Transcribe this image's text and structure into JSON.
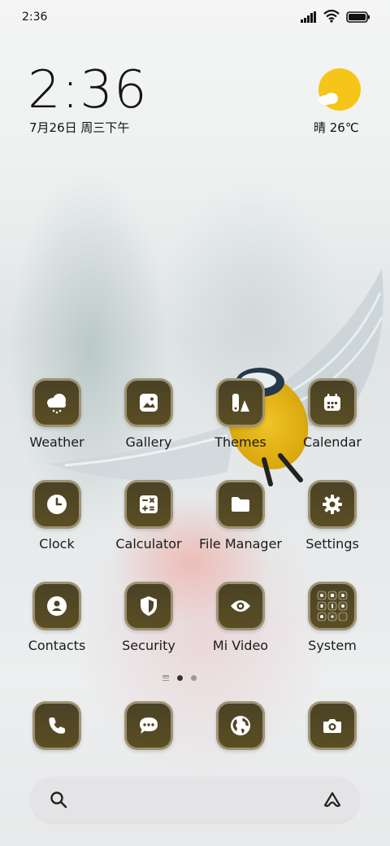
{
  "status_bar": {
    "time": "2:36"
  },
  "widget": {
    "time": "2:36",
    "date": "7月26日 周三下午",
    "weather": "晴 26℃"
  },
  "apps": [
    {
      "label": "Weather"
    },
    {
      "label": "Gallery"
    },
    {
      "label": "Themes"
    },
    {
      "label": "Calendar"
    },
    {
      "label": "Clock"
    },
    {
      "label": "Calculator"
    },
    {
      "label": "File Manager"
    },
    {
      "label": "Settings"
    },
    {
      "label": "Contacts"
    },
    {
      "label": "Security"
    },
    {
      "label": "Mi Video"
    },
    {
      "label": "System"
    }
  ],
  "page_indicator": {
    "pages": 2,
    "current": 1
  },
  "dock": [
    "phone-icon",
    "messages-icon",
    "browser-icon",
    "camera-icon"
  ],
  "colors": {
    "icon_bg": "#4f4524",
    "icon_border": "#aaa082",
    "sun": "#f5c518"
  }
}
